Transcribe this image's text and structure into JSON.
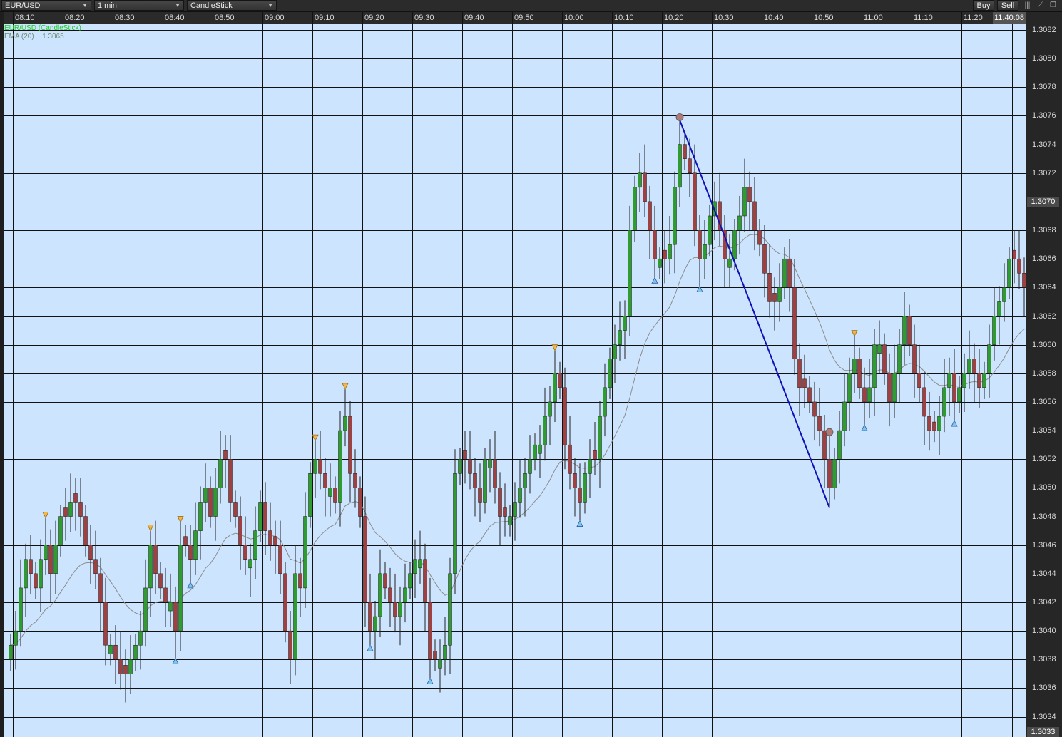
{
  "toolbar": {
    "symbol": "EUR/USD",
    "timeframe": "1 min",
    "chart_style": "CandleStick",
    "buy_label": "Buy",
    "sell_label": "Sell"
  },
  "legend": {
    "series_label": "EUR/USD (CandleStick)",
    "ema_label": "EMA (20) ~ 1.3065"
  },
  "time_labels": [
    "08:10",
    "08:20",
    "08:30",
    "08:40",
    "08:50",
    "09:00",
    "09:10",
    "09:20",
    "09:30",
    "09:40",
    "09:50",
    "10:00",
    "10:10",
    "10:20",
    "10:30",
    "10:40",
    "10:50",
    "11:00",
    "11:10",
    "11:20"
  ],
  "current_time": "11:40:08",
  "price_labels": [
    "1.3082",
    "1.3080",
    "1.3078",
    "1.3076",
    "1.3074",
    "1.3072",
    "1.3070",
    "1.3068",
    "1.3066",
    "1.3064",
    "1.3062",
    "1.3060",
    "1.3058",
    "1.3056",
    "1.3054",
    "1.3052",
    "1.3050",
    "1.3048",
    "1.3046",
    "1.3044",
    "1.3042",
    "1.3040",
    "1.3038",
    "1.3036",
    "1.3034"
  ],
  "current_price": "1.3070",
  "bottom_price": "1.3033",
  "colors": {
    "plot_bg": "#cce4fd",
    "up": "#2e9c2e",
    "down": "#a14040",
    "ema": "#8c8c8c",
    "trendline": "#1010b8",
    "up_signal": "#7ec4f0",
    "down_signal": "#f2b64a",
    "dot": "#b07a78"
  },
  "chart_data": {
    "type": "candlestick",
    "symbol": "EUR/USD",
    "interval": "1 min",
    "x_range": [
      "08:08",
      "11:40"
    ],
    "ylim": [
      1.3033,
      1.3083
    ],
    "grid": true,
    "series": [
      {
        "name": "EUR/USD",
        "close": [
          1.3039,
          1.304,
          1.3043,
          1.3045,
          1.3044,
          1.3043,
          1.3045,
          1.3046,
          1.3044,
          1.3046,
          1.3048,
          1.3048,
          1.3049,
          1.3049,
          1.3048,
          1.3046,
          1.3045,
          1.3044,
          1.3042,
          1.3039,
          1.3039,
          1.3038,
          1.3037,
          1.3037,
          1.3038,
          1.3039,
          1.304,
          1.3043,
          1.3046,
          1.3044,
          1.3043,
          1.3042,
          1.3042,
          1.304,
          1.3046,
          1.3046,
          1.3045,
          1.3047,
          1.3049,
          1.305,
          1.3048,
          1.305,
          1.3052,
          1.3052,
          1.3049,
          1.3048,
          1.3046,
          1.3045,
          1.3045,
          1.3047,
          1.3049,
          1.3047,
          1.3046,
          1.3046,
          1.3044,
          1.304,
          1.3038,
          1.3044,
          1.3043,
          1.3048,
          1.3051,
          1.3052,
          1.3051,
          1.305,
          1.305,
          1.3049,
          1.3054,
          1.3055,
          1.3051,
          1.305,
          1.3048,
          1.3042,
          1.304,
          1.3041,
          1.3044,
          1.3043,
          1.3042,
          1.3041,
          1.3042,
          1.3043,
          1.3044,
          1.3045,
          1.3045,
          1.3042,
          1.3038,
          1.3038,
          1.3038,
          1.3039,
          1.3044,
          1.3051,
          1.3052,
          1.3052,
          1.3051,
          1.305,
          1.3049,
          1.3052,
          1.3052,
          1.305,
          1.3048,
          1.3048,
          1.3048,
          1.3049,
          1.305,
          1.3051,
          1.3052,
          1.3053,
          1.3053,
          1.3055,
          1.3056,
          1.3058,
          1.3057,
          1.3053,
          1.3051,
          1.305,
          1.3049,
          1.3051,
          1.3052,
          1.3052,
          1.3055,
          1.3057,
          1.3059,
          1.306,
          1.3061,
          1.3062,
          1.3068,
          1.3071,
          1.3072,
          1.307,
          1.3068,
          1.3066,
          1.3066,
          1.3066,
          1.3067,
          1.3071,
          1.3074,
          1.3073,
          1.3072,
          1.3068,
          1.3066,
          1.3067,
          1.3069,
          1.307,
          1.3068,
          1.3066,
          1.3066,
          1.3068,
          1.3069,
          1.3071,
          1.307,
          1.3068,
          1.3067,
          1.3065,
          1.3063,
          1.3063,
          1.3064,
          1.3066,
          1.3064,
          1.3059,
          1.3057,
          1.3057,
          1.3056,
          1.3055,
          1.3054,
          1.3052,
          1.305,
          1.3052,
          1.3054,
          1.3056,
          1.3058,
          1.3059,
          1.3057,
          1.3056,
          1.3057,
          1.306,
          1.306,
          1.3058,
          1.3056,
          1.3058,
          1.306,
          1.3062,
          1.306,
          1.3058,
          1.3057,
          1.3055,
          1.3054,
          1.3054,
          1.3055,
          1.3057,
          1.3058,
          1.3056,
          1.3057,
          1.3058,
          1.3059,
          1.3058,
          1.3057,
          1.3058,
          1.306,
          1.3062,
          1.3063,
          1.3064,
          1.3066,
          1.3066,
          1.3065,
          1.3064,
          1.3062,
          1.3063,
          1.3064,
          1.3063,
          1.3064,
          1.3063,
          1.3064,
          1.3066,
          1.3067,
          1.3066,
          1.3062,
          1.3061,
          1.3062,
          1.3064,
          1.3065,
          1.3066,
          1.3067,
          1.3068,
          1.3068,
          1.3067,
          1.3069,
          1.307
        ]
      },
      {
        "name": "EMA (20)",
        "value_at_end": 1.3065
      }
    ]
  }
}
